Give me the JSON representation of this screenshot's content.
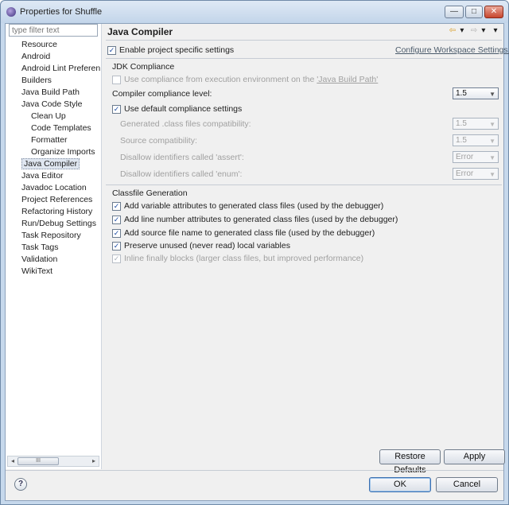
{
  "window": {
    "title": "Properties for Shuffle",
    "controls": {
      "minimize": "—",
      "maximize": "□",
      "close": "✕"
    }
  },
  "sidebar": {
    "filter_placeholder": "type filter text",
    "items": [
      {
        "label": "Resource",
        "level": 0
      },
      {
        "label": "Android",
        "level": 0
      },
      {
        "label": "Android Lint Preferen",
        "level": 0
      },
      {
        "label": "Builders",
        "level": 0
      },
      {
        "label": "Java Build Path",
        "level": 0
      },
      {
        "label": "Java Code Style",
        "level": 0
      },
      {
        "label": "Clean Up",
        "level": 1
      },
      {
        "label": "Code Templates",
        "level": 1
      },
      {
        "label": "Formatter",
        "level": 1
      },
      {
        "label": "Organize Imports",
        "level": 1
      },
      {
        "label": "Java Compiler",
        "level": 0,
        "selected": true
      },
      {
        "label": "Java Editor",
        "level": 0
      },
      {
        "label": "Javadoc Location",
        "level": 0
      },
      {
        "label": "Project References",
        "level": 0
      },
      {
        "label": "Refactoring History",
        "level": 0
      },
      {
        "label": "Run/Debug Settings",
        "level": 0
      },
      {
        "label": "Task Repository",
        "level": 0
      },
      {
        "label": "Task Tags",
        "level": 0
      },
      {
        "label": "Validation",
        "level": 0
      },
      {
        "label": "WikiText",
        "level": 0
      }
    ],
    "scroll_left": "◂",
    "scroll_right": "▸",
    "scroll_grip": "III"
  },
  "page": {
    "title": "Java Compiler",
    "nav": {
      "back": "⇦",
      "back_menu": "▾",
      "forward": "⇨",
      "forward_menu": "▾",
      "view_menu": "▾"
    },
    "enable_project_specific": {
      "label": "Enable project specific settings",
      "checked": true
    },
    "configure_workspace_link": "Configure Workspace Settings...",
    "jdk": {
      "title": "JDK Compliance",
      "use_env_prefix": "Use compliance from execution environment on the ",
      "use_env_link": "'Java Build Path'",
      "use_env_checked": false,
      "compliance_level_label": "Compiler compliance level:",
      "compliance_level_value": "1.5",
      "use_default": {
        "label": "Use default compliance settings",
        "checked": true
      },
      "rows": [
        {
          "label": "Generated .class files compatibility:",
          "value": "1.5"
        },
        {
          "label": "Source compatibility:",
          "value": "1.5"
        },
        {
          "label": "Disallow identifiers called 'assert':",
          "value": "Error"
        },
        {
          "label": "Disallow identifiers called 'enum':",
          "value": "Error"
        }
      ]
    },
    "classfile": {
      "title": "Classfile Generation",
      "options": [
        {
          "label": "Add variable attributes to generated class files (used by the debugger)",
          "checked": true,
          "enabled": true
        },
        {
          "label": "Add line number attributes to generated class files (used by the debugger)",
          "checked": true,
          "enabled": true
        },
        {
          "label": "Add source file name to generated class file (used by the debugger)",
          "checked": true,
          "enabled": true
        },
        {
          "label": "Preserve unused (never read) local variables",
          "checked": true,
          "enabled": true
        },
        {
          "label": "Inline finally blocks (larger class files, but improved performance)",
          "checked": true,
          "enabled": false
        }
      ]
    },
    "restore_defaults": "Restore Defaults",
    "apply": "Apply"
  },
  "footer": {
    "help": "?",
    "ok": "OK",
    "cancel": "Cancel"
  },
  "checkmark": "✓",
  "dropdown_glyph": "▼"
}
